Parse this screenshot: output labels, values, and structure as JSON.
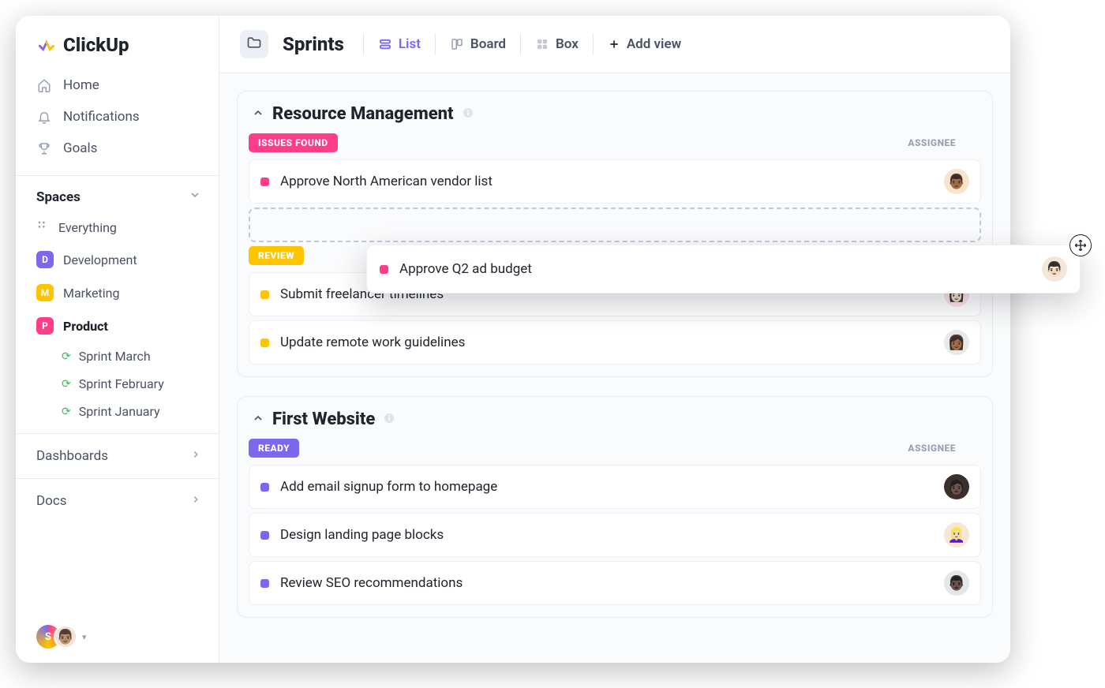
{
  "brand": {
    "name": "ClickUp"
  },
  "nav": {
    "home": "Home",
    "notifications": "Notifications",
    "goals": "Goals"
  },
  "spaces": {
    "heading": "Spaces",
    "everything": "Everything",
    "items": [
      {
        "letter": "D",
        "label": "Development"
      },
      {
        "letter": "M",
        "label": "Marketing"
      },
      {
        "letter": "P",
        "label": "Product"
      }
    ],
    "sprints": [
      {
        "label": "Sprint  March"
      },
      {
        "label": "Sprint  February"
      },
      {
        "label": "Sprint January"
      }
    ]
  },
  "sections": {
    "dashboards": "Dashboards",
    "docs": "Docs"
  },
  "footer_badge_letter": "S",
  "header": {
    "page_title": "Sprints",
    "views": {
      "list": "List",
      "board": "Board",
      "box": "Box",
      "add": "Add view"
    }
  },
  "columns": {
    "assignee": "ASSIGNEE"
  },
  "groups": [
    {
      "title": "Resource Management",
      "sections": [
        {
          "status": "ISSUES FOUND",
          "pill_class": "pill-pink",
          "dot": "d-pink",
          "show_assignee_header": true,
          "tasks": [
            {
              "name": "Approve North American vendor list",
              "avatar": "a",
              "avatar_bg": "#f6e5cc"
            }
          ],
          "has_dropzone": true
        },
        {
          "status": "REVIEW",
          "pill_class": "pill-yellow",
          "dot": "d-yellow",
          "show_assignee_header": false,
          "tasks": [
            {
              "name": "Submit freelancer timelines",
              "avatar": "b",
              "avatar_bg": "#fde3e5"
            },
            {
              "name": "Update remote work guidelines",
              "avatar": "c",
              "avatar_bg": "#e9e9e9"
            }
          ]
        }
      ]
    },
    {
      "title": "First Website",
      "sections": [
        {
          "status": "READY",
          "pill_class": "pill-purple",
          "dot": "d-purple",
          "show_assignee_header": true,
          "tasks": [
            {
              "name": "Add email signup form to homepage",
              "avatar": "d",
              "avatar_bg": "#3a2f2a"
            },
            {
              "name": "Design landing page blocks",
              "avatar": "e",
              "avatar_bg": "#f7e6d6"
            },
            {
              "name": "Review SEO recommendations",
              "avatar": "f",
              "avatar_bg": "#e3e7ea"
            }
          ]
        }
      ]
    }
  ],
  "dragged_task": {
    "name": "Approve Q2 ad budget",
    "dot": "d-pink",
    "avatar_bg": "#efe6dc"
  }
}
